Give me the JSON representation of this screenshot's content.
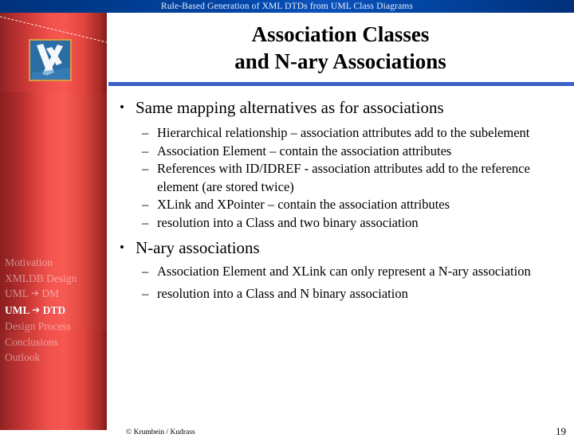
{
  "header": {
    "title": "Rule-Based Generation of XML DTDs from UML Class Diagrams"
  },
  "sidebar": {
    "logo_alt": "htwk-logo",
    "items": [
      {
        "label": "Motivation",
        "active": false
      },
      {
        "label": "XMLDB Design",
        "active": false
      },
      {
        "label": "UML ➔ DM",
        "active": false
      },
      {
        "label": "UML ➔ DTD",
        "active": true
      },
      {
        "label": "Design Process",
        "active": false
      },
      {
        "label": "Conclusions",
        "active": false
      },
      {
        "label": "Outlook",
        "active": false
      }
    ]
  },
  "slide": {
    "title_line1": "Association Classes",
    "title_line2": "and N-ary Associations",
    "bullet_mark": "•",
    "dash_mark": "–",
    "sections": [
      {
        "heading": "Same mapping alternatives as for associations",
        "items": [
          "Hierarchical relationship – association attributes add to the subelement",
          "Association Element – contain the association attributes",
          "References with ID/IDREF - association attributes add to the reference element (are stored twice)",
          "XLink and XPointer – contain the association attributes",
          "resolution into a Class and two binary association"
        ]
      },
      {
        "heading": "N-ary associations",
        "items": [
          "Association Element and XLink can only represent a N-ary association",
          "resolution into a Class and N binary association"
        ]
      }
    ]
  },
  "footer": {
    "copyright": "© Krumbein / Kudrass",
    "page_number": "19"
  },
  "colors": {
    "header_blue": "#01317a",
    "sidebar_red": "#f1514c",
    "rule_blue": "#3b62c8",
    "logo_border": "#d99a3c",
    "logo_bg": "#2b6ea6"
  }
}
